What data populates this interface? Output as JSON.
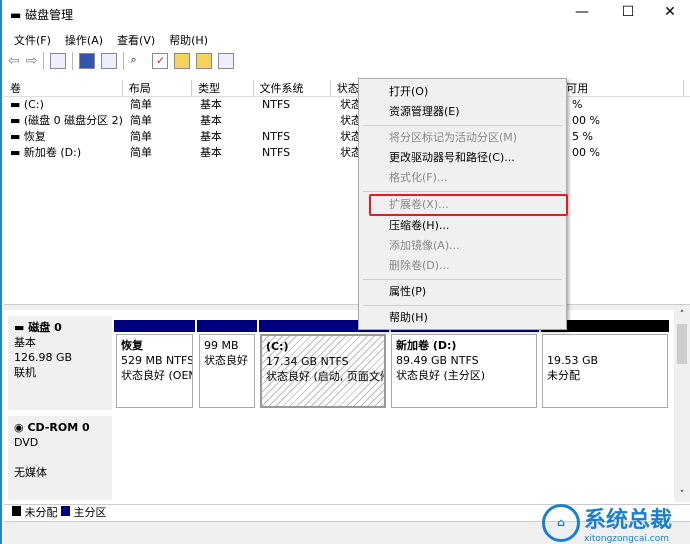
{
  "window": {
    "title": "磁盘管理",
    "minimize": "—",
    "maximize": "☐",
    "close": "✕"
  },
  "menu": [
    "文件(F)",
    "操作(A)",
    "查看(V)",
    "帮助(H)"
  ],
  "columns": [
    "卷",
    "布局",
    "类型",
    "文件系统",
    "状态",
    "可用"
  ],
  "rows": [
    {
      "vol": "(C:)",
      "layout": "简单",
      "type": "基本",
      "fs": "NTFS",
      "status": "状态",
      "free": "%"
    },
    {
      "vol": "(磁盘 0 磁盘分区 2)",
      "layout": "简单",
      "type": "基本",
      "fs": "",
      "status": "状态",
      "free": "00 %"
    },
    {
      "vol": "恢复",
      "layout": "简单",
      "type": "基本",
      "fs": "NTFS",
      "status": "状态",
      "free": "5 %"
    },
    {
      "vol": "新加卷 (D:)",
      "layout": "简单",
      "type": "基本",
      "fs": "NTFS",
      "status": "状态",
      "free": "00 %"
    }
  ],
  "context_menu": [
    {
      "label": "打开(O)",
      "enabled": true
    },
    {
      "label": "资源管理器(E)",
      "enabled": true
    },
    {
      "label": "将分区标记为活动分区(M)",
      "enabled": false
    },
    {
      "label": "更改驱动器号和路径(C)...",
      "enabled": true
    },
    {
      "label": "格式化(F)...",
      "enabled": false
    },
    {
      "label": "扩展卷(X)...",
      "enabled": false,
      "highlighted": true
    },
    {
      "label": "压缩卷(H)...",
      "enabled": true
    },
    {
      "label": "添加镜像(A)...",
      "enabled": false
    },
    {
      "label": "删除卷(D)...",
      "enabled": false
    },
    {
      "label": "属性(P)",
      "enabled": true
    },
    {
      "label": "帮助(H)",
      "enabled": true
    }
  ],
  "disk0": {
    "name": "磁盘 0",
    "type": "基本",
    "size": "126.98 GB",
    "state": "联机",
    "partitions": [
      {
        "name": "恢复",
        "size": "529 MB NTFS",
        "status": "状态良好 (OEM"
      },
      {
        "name": "",
        "size": "99 MB",
        "status": "状态良好"
      },
      {
        "name": "(C:)",
        "size": "17.34 GB NTFS",
        "status": "状态良好 (启动, 页面文件"
      },
      {
        "name": "新加卷 (D:)",
        "size": "89.49 GB NTFS",
        "status": "状态良好 (主分区)"
      },
      {
        "name": "",
        "size": "19.53 GB",
        "status": "未分配"
      }
    ]
  },
  "cdrom": {
    "name": "CD-ROM 0",
    "type": "DVD",
    "state": "无媒体"
  },
  "legend": [
    "未分配",
    "主分区"
  ],
  "watermark": {
    "name": "系统总裁",
    "url": "xitongzongcai.com"
  },
  "colors": {
    "primary": "#00007f",
    "unallocated": "#000000",
    "highlight": "#e02020"
  }
}
